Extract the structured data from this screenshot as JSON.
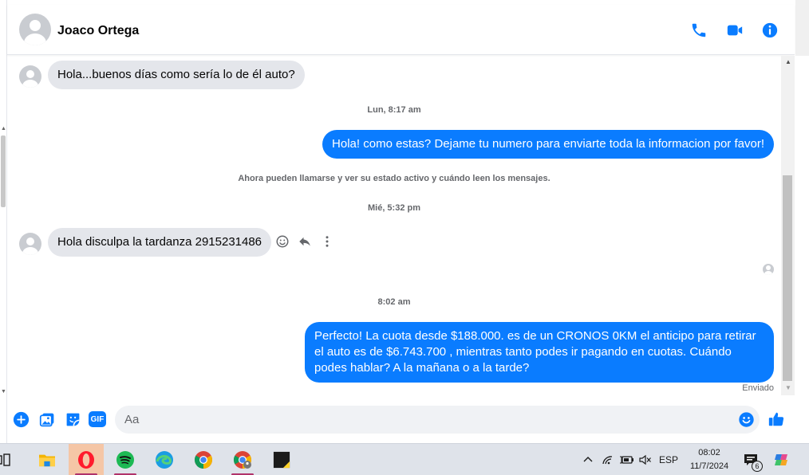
{
  "header": {
    "contact_name": "Joaco Ortega",
    "icons": [
      "phone-icon",
      "video-camera-icon",
      "info-icon"
    ]
  },
  "messages": [
    {
      "direction": "in",
      "text": "Hola...buenos días como sería lo de él auto?"
    },
    {
      "type": "timestamp",
      "text": "Lun, 8:17 am"
    },
    {
      "direction": "out",
      "text": "Hola! como estas? Dejame tu numero para enviarte toda la informacion por favor!"
    },
    {
      "type": "system",
      "text": "Ahora pueden llamarse y ver su estado activo y cuándo leen los mensajes."
    },
    {
      "type": "timestamp",
      "text": "Mié, 5:32 pm"
    },
    {
      "direction": "in",
      "text": "Hola disculpa la tardanza 2915231486"
    },
    {
      "type": "timestamp",
      "text": "8:02 am"
    },
    {
      "direction": "out",
      "text": "Perfecto! La cuota desde $188.000. es de un CRONOS 0KM el anticipo para retirar el auto es de $6.743.700 , mientras tanto podes ir pagando en cuotas. Cuándo podes hablar? A la mañana o a la tarde?"
    },
    {
      "type": "status",
      "text": "Enviado"
    }
  ],
  "composer": {
    "placeholder": "Aa",
    "value": "",
    "left_icons": [
      "plus-icon",
      "image-icon",
      "sticker-icon"
    ],
    "gif_label": "GIF",
    "right_icons": [
      "emoji-icon",
      "thumbs-up-icon"
    ]
  },
  "taskbar": {
    "apps": [
      "task-view",
      "file-explorer",
      "opera",
      "spotify",
      "edge",
      "chrome",
      "chrome-profile",
      "sticky-notes"
    ],
    "language": "ESP",
    "time": "08:02",
    "date": "11/7/2024",
    "notification_count": "6",
    "accent_color": "#b0326a"
  },
  "colors": {
    "brand_blue": "#0a7cff",
    "incoming_bubble": "#e4e6eb",
    "text_primary": "#050505",
    "text_secondary": "#65676b"
  }
}
